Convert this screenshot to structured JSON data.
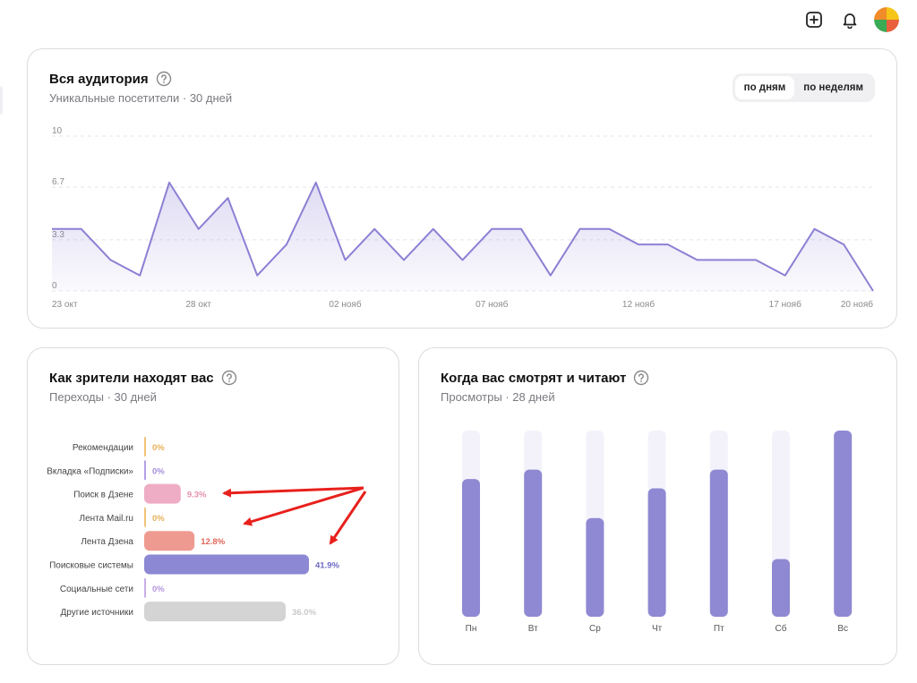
{
  "header": {
    "icons": [
      "plus-square-icon",
      "bell-icon"
    ],
    "avatar_colors": [
      "#f5c518",
      "#e8603c",
      "#3aaa55",
      "#f08c2a"
    ]
  },
  "audience": {
    "title": "Вся аудитория",
    "subtitle": "Уникальные посетители · 30 дней",
    "toggle": {
      "days_label": "по дням",
      "weeks_label": "по неделям",
      "active": "days"
    }
  },
  "sources": {
    "title": "Как зрители находят вас",
    "subtitle": "Переходы · 30 дней"
  },
  "weekly": {
    "title": "Когда вас смотрят и читают",
    "subtitle": "Просмотры · 28 дней"
  },
  "chart_data": [
    {
      "type": "area",
      "y_ticks": [
        "10",
        "6.7",
        "3.3",
        "0"
      ],
      "ylim": [
        0,
        10
      ],
      "x_labels": [
        {
          "index": 0,
          "label": "23 окт"
        },
        {
          "index": 5,
          "label": "28 окт"
        },
        {
          "index": 10,
          "label": "02 нояб"
        },
        {
          "index": 15,
          "label": "07 нояб"
        },
        {
          "index": 20,
          "label": "12 нояб"
        },
        {
          "index": 25,
          "label": "17 нояб"
        },
        {
          "index": 28,
          "label": "20 нояб"
        }
      ],
      "values": [
        4,
        4,
        2,
        1,
        7,
        4,
        6,
        1,
        3,
        7,
        2,
        4,
        2,
        4,
        2,
        4,
        4,
        1,
        4,
        4,
        3,
        3,
        2,
        2,
        2,
        1,
        4,
        3,
        0
      ],
      "color": "#8b80d4",
      "grid": true
    },
    {
      "type": "bar",
      "orientation": "horizontal",
      "categories": [
        "Рекомендации",
        "Вкладка «Подписки»",
        "Поиск в Дзене",
        "Лента Mail.ru",
        "Лента Дзена",
        "Поисковые системы",
        "Социальные сети",
        "Другие источники"
      ],
      "values": [
        0,
        0,
        9.3,
        0,
        12.8,
        41.9,
        0,
        36.0
      ],
      "value_labels": [
        "0%",
        "0%",
        "9.3%",
        "0%",
        "12.8%",
        "41.9%",
        "0%",
        "36.0%"
      ],
      "colors": [
        "#f1c27a",
        "#b3a0e6",
        "#eeadc4",
        "#f1c27a",
        "#ef9a90",
        "#8c88d4",
        "#c9aee8",
        "#d4d4d4"
      ],
      "label_colors": [
        "#e7b058",
        "#a58fdb",
        "#e690ae",
        "#e7b058",
        "#e2665a",
        "#6f6ac4",
        "#b596dc",
        "#c9c9c9"
      ]
    },
    {
      "type": "bar",
      "categories": [
        "Пн",
        "Вт",
        "Ср",
        "Чт",
        "Пт",
        "Сб",
        "Вс"
      ],
      "values": [
        74,
        79,
        53,
        69,
        79,
        31,
        100
      ],
      "color": "#8f89d3",
      "track_color": "#f3f2fa"
    }
  ]
}
